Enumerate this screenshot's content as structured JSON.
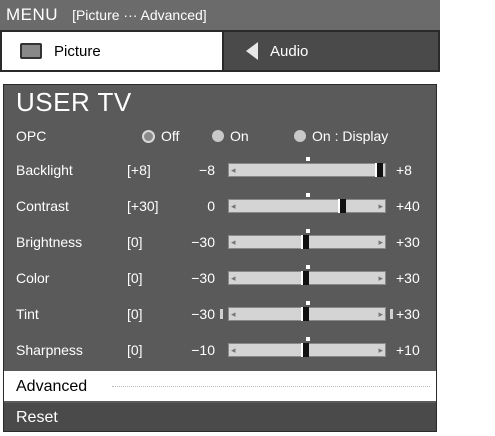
{
  "menu": {
    "title": "MENU",
    "breadcrumb": "[Picture ··· Advanced]"
  },
  "tabs": [
    {
      "label": "Picture",
      "icon": "tv-icon",
      "selected": true
    },
    {
      "label": "Audio",
      "icon": "speaker-icon",
      "selected": false
    }
  ],
  "panel": {
    "title": "USER TV"
  },
  "opc": {
    "label": "OPC",
    "options": [
      "Off",
      "On",
      "On : Display"
    ],
    "selected": "Off"
  },
  "sliders": [
    {
      "label": "Backlight",
      "current": "[+8]",
      "min_label": "−8",
      "max_label": "+8",
      "min": -8,
      "max": 8,
      "value": 8
    },
    {
      "label": "Contrast",
      "current": "[+30]",
      "min_label": "0",
      "max_label": "+40",
      "min": 0,
      "max": 40,
      "value": 30
    },
    {
      "label": "Brightness",
      "current": "[0]",
      "min_label": "−30",
      "max_label": "+30",
      "min": -30,
      "max": 30,
      "value": 0
    },
    {
      "label": "Color",
      "current": "[0]",
      "min_label": "−30",
      "max_label": "+30",
      "min": -30,
      "max": 30,
      "value": 0
    },
    {
      "label": "Tint",
      "current": "[0]",
      "min_label": "−30",
      "max_label": "+30",
      "min": -30,
      "max": 30,
      "value": 0
    },
    {
      "label": "Sharpness",
      "current": "[0]",
      "min_label": "−10",
      "max_label": "+10",
      "min": -10,
      "max": 10,
      "value": 0
    }
  ],
  "advanced": {
    "label": "Advanced"
  },
  "reset": {
    "label": "Reset"
  }
}
